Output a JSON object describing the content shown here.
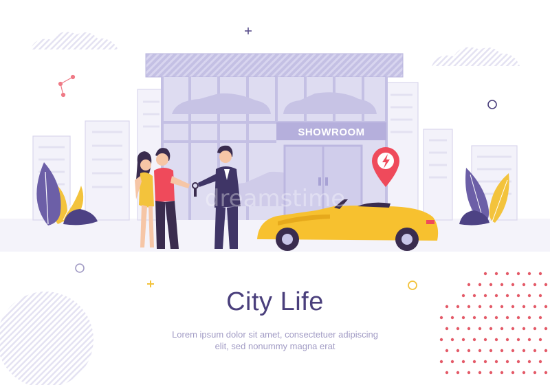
{
  "showroom_sign": "SHOWROOM",
  "headline": "City Life",
  "body_text_line1": "Lorem ipsum dolor sit amet, consectetuer adipiscing",
  "body_text_line2": "elit, sed nonummy magna erat",
  "watermark": "dreamstime",
  "colors": {
    "background": "#ffffff",
    "building": "#c9c5e8",
    "glass": "#dcdaf1",
    "car": "#f7c12f",
    "headline": "#4a3f7c",
    "body_text": "#a19bc4",
    "pin": "#ef4a5b",
    "dots": "#e35a68",
    "leaf_purple": "#6c5fa7",
    "leaf_yellow": "#f3c33c"
  },
  "icons": [
    "location-pin-lightning-icon",
    "plus-icon",
    "circle-icon",
    "molecule-icon"
  ]
}
